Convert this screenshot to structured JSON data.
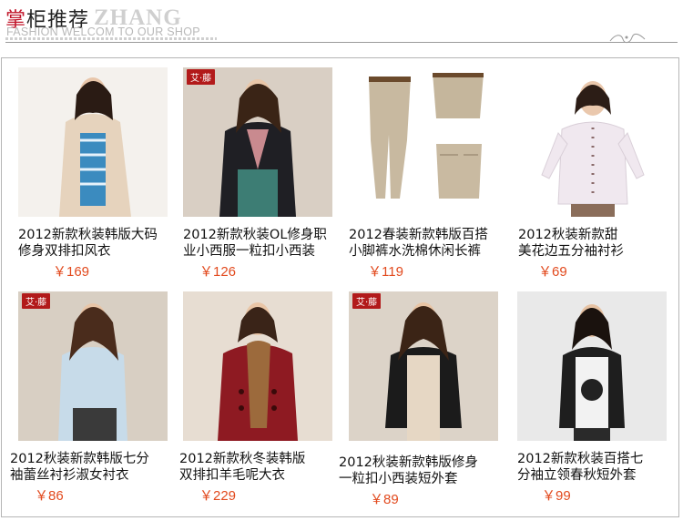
{
  "header": {
    "title_first_char": "掌",
    "title_rest": "柜推荐",
    "title_en": "ZHANG",
    "slogan": "FASHION  WELCOM TO OUR SHOP"
  },
  "colors": {
    "accent": "#c0152a",
    "price": "#e24a1e",
    "border": "#b5b5b5"
  },
  "products": [
    {
      "title": "2012新款秋装韩版大码\n修身双排扣风衣",
      "price": "￥169",
      "tag": ""
    },
    {
      "title": "2012新款秋装OL修身职\n业小西服一粒扣小西装",
      "price": "￥126",
      "tag": "艾·藤"
    },
    {
      "title": "2012春装新款韩版百搭\n小脚裤水洗棉休闲长裤",
      "price": "￥119",
      "tag": ""
    },
    {
      "title": "2012秋装新款甜\n美花边五分袖衬衫",
      "price": "￥69",
      "tag": ""
    },
    {
      "title": "2012秋装新款韩版七分\n袖蕾丝衬衫淑女衬衣",
      "price": "￥86",
      "tag": "艾·藤"
    },
    {
      "title": "2012新款秋冬装韩版\n双排扣羊毛呢大衣",
      "price": "￥229",
      "tag": ""
    },
    {
      "title": "2012秋装新款韩版修身\n一粒扣小西装短外套",
      "price": "￥89",
      "tag": "艾·藤"
    },
    {
      "title": "2012新款秋装百搭七\n分袖立领春秋短外套",
      "price": "￥99",
      "tag": ""
    }
  ]
}
